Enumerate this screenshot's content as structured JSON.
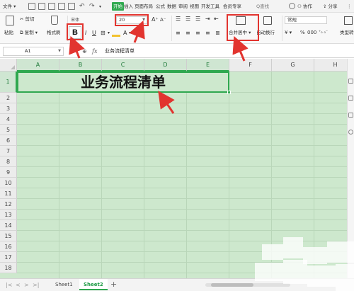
{
  "menu": {
    "file": "文件",
    "tabs": [
      "开始",
      "插入",
      "页面布局",
      "公式",
      "数据",
      "审阅",
      "视图",
      "开发工具",
      "会员专享"
    ],
    "active_tab": "开始",
    "search": "Q查找",
    "collab": "协作",
    "share": "分享"
  },
  "ribbon": {
    "cut": "剪切",
    "copy": "复制",
    "paste": "粘贴",
    "format_painter": "格式刷",
    "font_name": "宋体",
    "font_size": "20",
    "bold": "B",
    "merge_center": "合并居中",
    "wrap_text": "自动换行",
    "number_format": "常规",
    "percent": "%",
    "cell_type": "类型转换"
  },
  "formula_bar": {
    "cell_ref": "A1",
    "fx": "fx",
    "content": "业务流程清单"
  },
  "sheet": {
    "columns": [
      "A",
      "B",
      "C",
      "D",
      "E",
      "F",
      "G",
      "H"
    ],
    "rows": [
      "1",
      "2",
      "3",
      "4",
      "5",
      "6",
      "7",
      "8",
      "9",
      "10",
      "11",
      "12",
      "13",
      "14",
      "15",
      "16",
      "17",
      "18"
    ],
    "merged_text": "业务流程清单",
    "cell_fill": "#cde8cd",
    "selection_color": "#2fa84f"
  },
  "tabs": {
    "sheets": [
      "Sheet1",
      "Sheet2"
    ],
    "active": "Sheet2",
    "add": "+"
  },
  "colors": {
    "accent": "#2fa84f",
    "annotation": "#e2342f"
  }
}
